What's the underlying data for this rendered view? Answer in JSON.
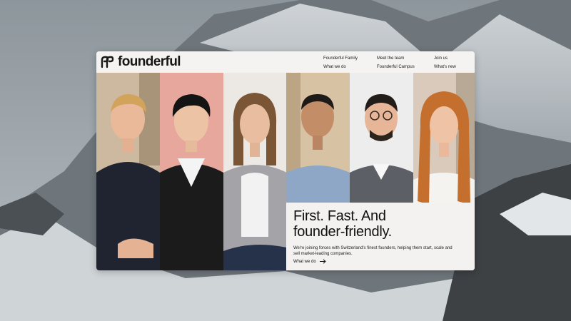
{
  "brand": {
    "name": "founderful"
  },
  "nav": {
    "items": [
      {
        "label": "Founderful Family"
      },
      {
        "label": "What we do"
      },
      {
        "label": "Meet the team"
      },
      {
        "label": "Founderful Campus"
      },
      {
        "label": "Join us"
      },
      {
        "label": "What's new"
      }
    ]
  },
  "hero": {
    "headline_line1": "First. Fast. And",
    "headline_line2": "founder-friendly.",
    "subtext": "We're joining forces with Switzerland's finest founders, helping them start, scale and sell market-leading companies.",
    "cta_label": "What we do"
  },
  "team_photos": [
    {
      "icon": "portrait-1"
    },
    {
      "icon": "portrait-2"
    },
    {
      "icon": "portrait-3"
    },
    {
      "icon": "portrait-4"
    },
    {
      "icon": "portrait-5"
    },
    {
      "icon": "portrait-6"
    }
  ],
  "colors": {
    "page_bg": "#f3f2f1",
    "text": "#111111",
    "accent_panel": "#e8a79c"
  }
}
